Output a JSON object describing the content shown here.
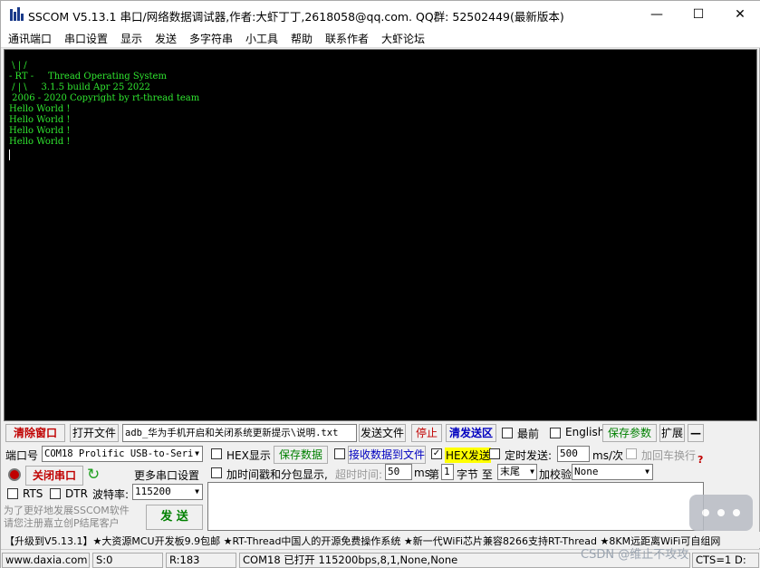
{
  "window": {
    "title": "SSCOM V5.13.1 串口/网络数据调试器,作者:大虾丁丁,2618058@qq.com. QQ群: 52502449(最新版本)",
    "minimize": "—",
    "maximize": "☐",
    "close": "✕"
  },
  "menu": [
    "通讯端口",
    "串口设置",
    "显示",
    "发送",
    "多字符串",
    "小工具",
    "帮助",
    "联系作者",
    "大虾论坛"
  ],
  "terminal": {
    "lines": " \\ | /\n- RT -     Thread Operating System\n / | \\     3.1.5 build Apr 25 2022\n 2006 - 2020 Copyright by rt-thread team\nHello World !\nHello World !\nHello World !\nHello World !",
    "text_color": "#30e830",
    "background": "#000000"
  },
  "toolbar": {
    "clear_window": "清除窗口",
    "open_file": "打开文件",
    "file_path": "adb_华为手机开启和关闭系统更新提示\\说明.txt",
    "send_file": "发送文件",
    "stop": "停止",
    "clear_send": "清发送区",
    "topmost": "最前",
    "english": "English",
    "save_params": "保存参数",
    "expand": "扩展",
    "collapse": "—"
  },
  "port": {
    "port_label": "端口号",
    "port_value": "COM18 Prolific USB-to-Seri",
    "close_port": "关闭串口",
    "more_settings": "更多串口设置",
    "rts": "RTS",
    "dtr": "DTR",
    "baud_label": "波特率:",
    "baud_value": "115200",
    "promo_line1": "为了更好地发展SSCOM软件",
    "promo_line2": "请您注册嘉立创P结尾客户",
    "send": "发 送"
  },
  "options": {
    "hex_display": "HEX显示",
    "save_data": "保存数据",
    "recv_to_file": "接收数据到文件",
    "hex_send": "HEX发送",
    "timed_send": "定时发送:",
    "timed_value": "500",
    "timed_unit": "ms/次",
    "add_crlf": "加回车换行",
    "add_timestamp": "加时间戳和分包显示,",
    "timeout_label": "超时时间:",
    "timeout_value": "50",
    "timeout_unit": "ms",
    "nth_label": "第",
    "nth_value": "1",
    "byte_label": "字节 至",
    "end_value": "末尾",
    "checksum_label": "加校验",
    "checksum_value": "None"
  },
  "marquee": "【升级到V5.13.1】★大资源MCU开发板9.9包邮 ★RT-Thread中国人的开源免费操作系统 ★新一代WiFi芯片兼容8266支持RT-Thread ★8KM远距离WiFi可自组网",
  "status": {
    "website": "www.daxia.com",
    "sent": "S:0",
    "received": "R:183",
    "port_state": "COM18 已打开  115200bps,8,1,None,None",
    "cts": "CTS=1 D:"
  },
  "watermark": "CSDN @维止不攻攻",
  "colors": {
    "accent_red": "#c00000",
    "accent_blue": "#0000c0",
    "accent_green": "#008000",
    "hex_send_highlight": "#ffff00"
  }
}
